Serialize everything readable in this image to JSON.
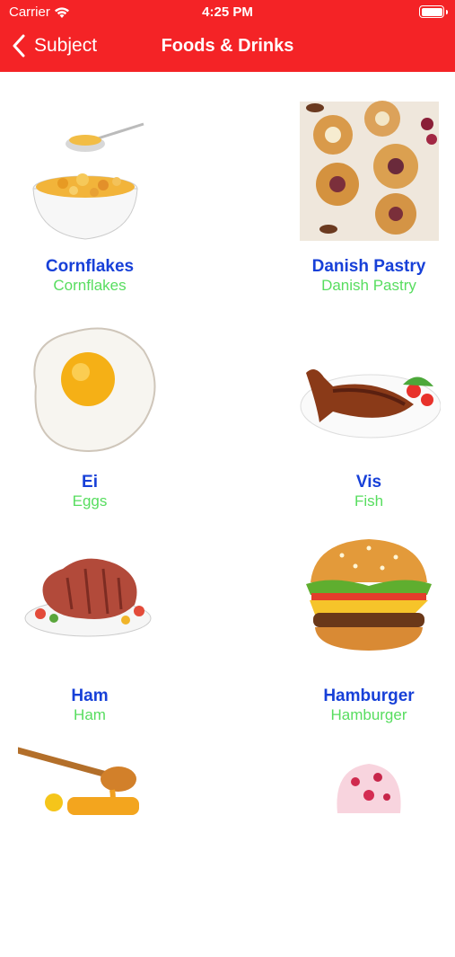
{
  "status": {
    "carrier": "Carrier",
    "time": "4:25 PM"
  },
  "nav": {
    "back_label": "Subject",
    "title": "Foods & Drinks"
  },
  "items": [
    {
      "name": "Cornflakes",
      "translation": "Cornflakes",
      "icon": "cornflakes-image"
    },
    {
      "name": "Danish Pastry",
      "translation": "Danish Pastry",
      "icon": "danish-pastry-image"
    },
    {
      "name": "Ei",
      "translation": "Eggs",
      "icon": "fried-egg-image"
    },
    {
      "name": "Vis",
      "translation": "Fish",
      "icon": "fish-dish-image"
    },
    {
      "name": "Ham",
      "translation": "Ham",
      "icon": "ham-image"
    },
    {
      "name": "Hamburger",
      "translation": "Hamburger",
      "icon": "hamburger-image"
    },
    {
      "name": "",
      "translation": "",
      "icon": "honey-image"
    },
    {
      "name": "",
      "translation": "",
      "icon": "ice-cream-image"
    }
  ],
  "colors": {
    "header": "#f42326",
    "name": "#1740d8",
    "translation": "#57dd5f"
  }
}
